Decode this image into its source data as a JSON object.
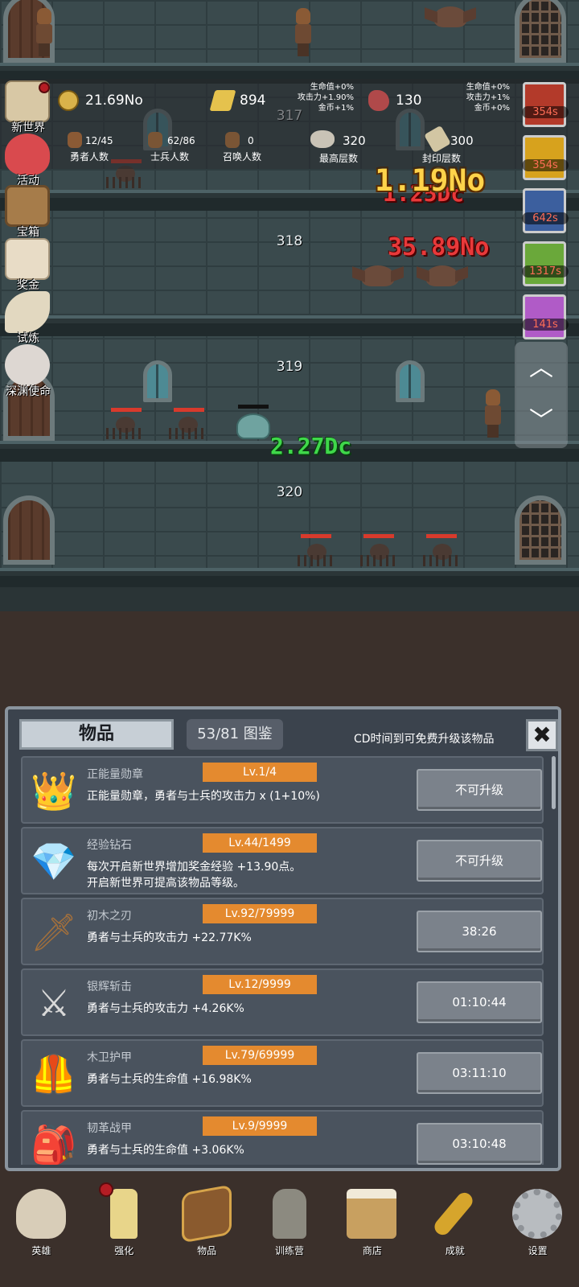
{
  "top_stats": {
    "gold": "21.69No",
    "gold_bar": "894",
    "meat": "130",
    "floor_317": "317",
    "bonus_left": [
      "生命值+0%",
      "攻击力+1.90%",
      "金币+1%"
    ],
    "bonus_right": [
      "生命值+0%",
      "攻击力+1%",
      "金币+0%"
    ],
    "hero_count": "12/45",
    "hero_count_label": "勇者人数",
    "soldier_count": "62/86",
    "soldier_count_label": "士兵人数",
    "summon_count": "0",
    "summon_count_label": "召唤人数",
    "max_floor": "320",
    "max_floor_label": "最高层数",
    "seal_floor": "300",
    "seal_floor_label": "封印层数"
  },
  "side_menu": {
    "items": [
      {
        "label": "新世界",
        "icon": "map-icon"
      },
      {
        "label": "活动",
        "icon": "heart-icon"
      },
      {
        "label": "宝箱",
        "icon": "chest-icon"
      },
      {
        "label": "奖金",
        "icon": "envelope-icon"
      },
      {
        "label": "试炼",
        "icon": "feather-icon"
      },
      {
        "label": "深渊使命",
        "icon": "pearl-icon"
      }
    ]
  },
  "buffs": [
    {
      "timer": "354s",
      "color": "#b33a2a"
    },
    {
      "timer": "354s",
      "color": "#d7a21d"
    },
    {
      "timer": "642s",
      "color": "#3c5f9e"
    },
    {
      "timer": "1317s",
      "color": "#6aa83a"
    },
    {
      "timer": "141s",
      "color": "#b05bc7"
    }
  ],
  "floors": {
    "f318": "318",
    "f319": "319",
    "f320": "320"
  },
  "damage": {
    "gold": "1.19No",
    "red_behind": "1.25Dc",
    "red": "35.89No",
    "green": "2.27Dc"
  },
  "scroll": {
    "up": "︿",
    "down": "﹀"
  },
  "panel": {
    "title": "物品",
    "codex": "53/81 图鉴",
    "cd_text": "CD时间到可免费升级该物品",
    "close": "✖",
    "items": [
      {
        "icon": "crown-icon",
        "glyph": "👑",
        "name": "正能量勋章",
        "level": "Lv.1/4",
        "desc": "正能量勋章，勇者与士兵的攻击力 x (1+10%)",
        "button": "不可升级"
      },
      {
        "icon": "diamond-icon",
        "glyph": "💎",
        "name": "经验钻石",
        "level": "Lv.44/1499",
        "desc": "每次开启新世界增加奖金经验 +13.90点。\n开启新世界可提高该物品等级。",
        "button": "不可升级"
      },
      {
        "icon": "wooden-sword-icon",
        "glyph": "🗡",
        "name": "初木之刃",
        "level": "Lv.92/79999",
        "desc": "勇者与士兵的攻击力 +22.77K%",
        "button": "38:26"
      },
      {
        "icon": "silver-sword-icon",
        "glyph": "⚔",
        "name": "银辉斩击",
        "level": "Lv.12/9999",
        "desc": "勇者与士兵的攻击力 +4.26K%",
        "button": "01:10:44"
      },
      {
        "icon": "wood-armor-icon",
        "glyph": "🦺",
        "name": "木卫护甲",
        "level": "Lv.79/69999",
        "desc": "勇者与士兵的生命值 +16.98K%",
        "button": "03:11:10"
      },
      {
        "icon": "leather-armor-icon",
        "glyph": "🎒",
        "name": "韧革战甲",
        "level": "Lv.9/9999",
        "desc": "勇者与士兵的生命值 +3.06K%",
        "button": "03:10:48"
      }
    ]
  },
  "nav": [
    {
      "label": "英雄",
      "icon": "skull-icon",
      "color": "#d8cdb8"
    },
    {
      "label": "强化",
      "icon": "candle-icon",
      "color": "#e8d58a"
    },
    {
      "label": "物品",
      "icon": "book-icon",
      "color": "#8a5a2e"
    },
    {
      "label": "训练营",
      "icon": "lantern-icon",
      "color": "#8c8a80"
    },
    {
      "label": "商店",
      "icon": "beer-icon",
      "color": "#c8a060"
    },
    {
      "label": "成就",
      "icon": "key-icon",
      "color": "#d6a52c"
    },
    {
      "label": "设置",
      "icon": "gear-icon",
      "color": "#b8bcc0"
    }
  ]
}
